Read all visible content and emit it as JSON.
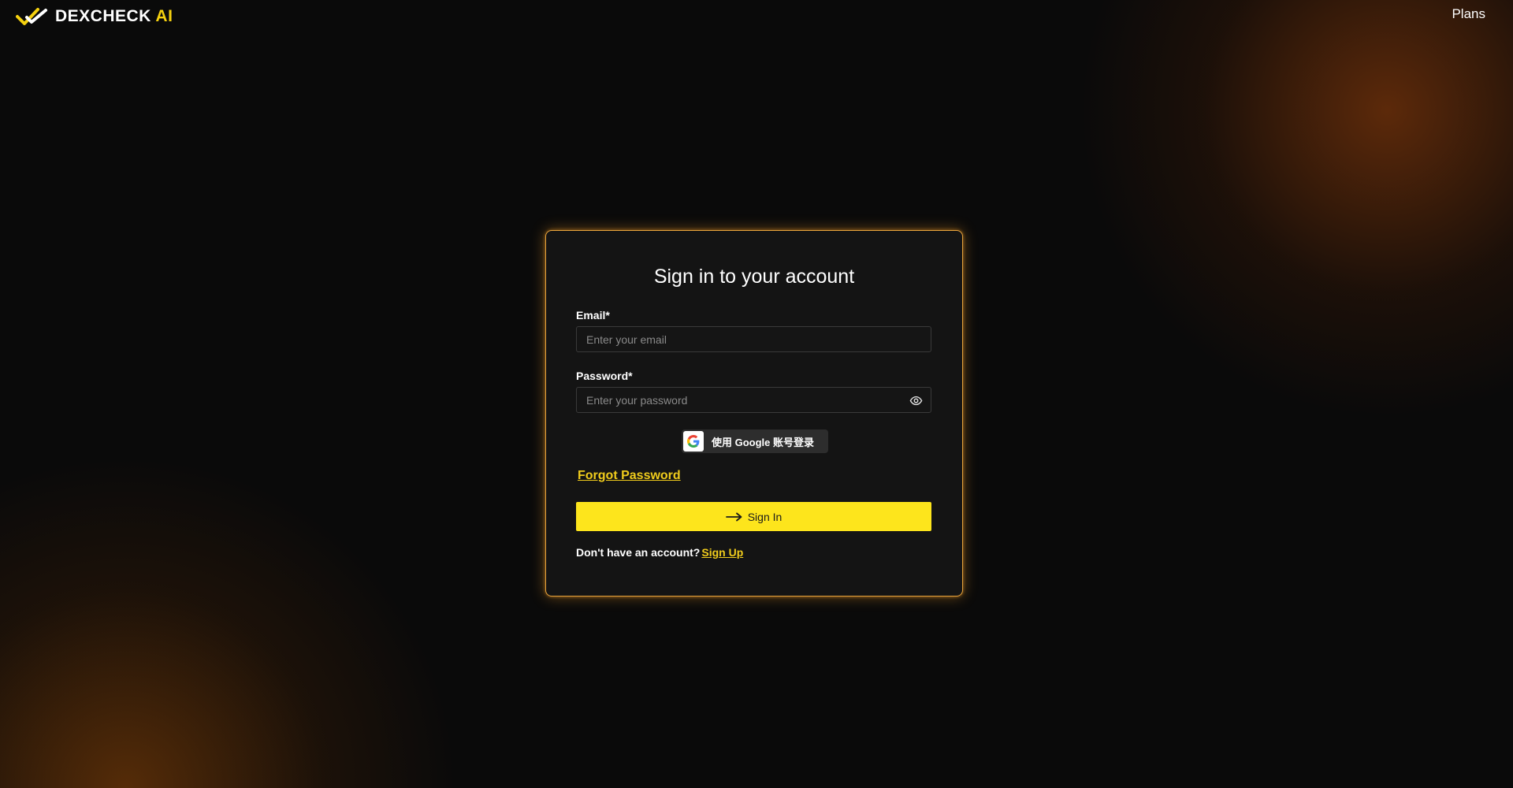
{
  "header": {
    "logo_text_main": "DEXCHECK",
    "logo_text_accent": "AI",
    "logo_icon": "checkmark-logo-icon",
    "nav_plans": "Plans"
  },
  "colors": {
    "accent_yellow": "#fde51c",
    "link_yellow": "#f0cc1c",
    "card_border": "#e6a23c",
    "card_background": "#141414",
    "page_background": "#0a0a0a"
  },
  "form": {
    "title": "Sign in to your account",
    "email_label": "Email*",
    "email_placeholder": "Enter your email",
    "email_value": "",
    "password_label": "Password*",
    "password_placeholder": "Enter your password",
    "password_value": "",
    "password_toggle_icon": "eye-icon",
    "google_button_label": "使用 Google 账号登录",
    "google_icon": "google-g-icon",
    "forgot_password": "Forgot Password",
    "submit_label": "Sign In",
    "submit_icon": "arrow-right-icon",
    "no_account_text": "Don't have an account?",
    "signup_link": "Sign Up"
  }
}
